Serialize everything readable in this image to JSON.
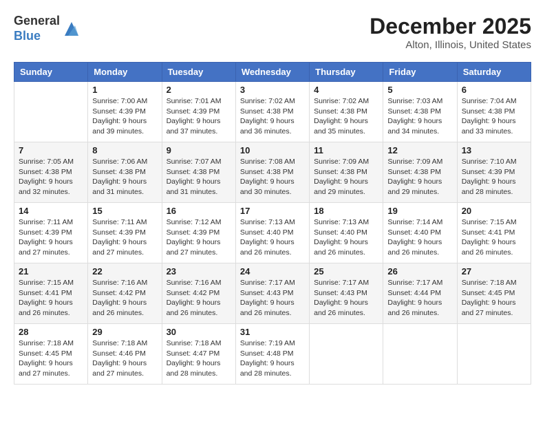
{
  "header": {
    "logo_line1": "General",
    "logo_line2": "Blue",
    "month_title": "December 2025",
    "location": "Alton, Illinois, United States"
  },
  "weekdays": [
    "Sunday",
    "Monday",
    "Tuesday",
    "Wednesday",
    "Thursday",
    "Friday",
    "Saturday"
  ],
  "weeks": [
    [
      {
        "day": "",
        "info": ""
      },
      {
        "day": "1",
        "info": "Sunrise: 7:00 AM\nSunset: 4:39 PM\nDaylight: 9 hours\nand 39 minutes."
      },
      {
        "day": "2",
        "info": "Sunrise: 7:01 AM\nSunset: 4:39 PM\nDaylight: 9 hours\nand 37 minutes."
      },
      {
        "day": "3",
        "info": "Sunrise: 7:02 AM\nSunset: 4:38 PM\nDaylight: 9 hours\nand 36 minutes."
      },
      {
        "day": "4",
        "info": "Sunrise: 7:02 AM\nSunset: 4:38 PM\nDaylight: 9 hours\nand 35 minutes."
      },
      {
        "day": "5",
        "info": "Sunrise: 7:03 AM\nSunset: 4:38 PM\nDaylight: 9 hours\nand 34 minutes."
      },
      {
        "day": "6",
        "info": "Sunrise: 7:04 AM\nSunset: 4:38 PM\nDaylight: 9 hours\nand 33 minutes."
      }
    ],
    [
      {
        "day": "7",
        "info": "Sunrise: 7:05 AM\nSunset: 4:38 PM\nDaylight: 9 hours\nand 32 minutes."
      },
      {
        "day": "8",
        "info": "Sunrise: 7:06 AM\nSunset: 4:38 PM\nDaylight: 9 hours\nand 31 minutes."
      },
      {
        "day": "9",
        "info": "Sunrise: 7:07 AM\nSunset: 4:38 PM\nDaylight: 9 hours\nand 31 minutes."
      },
      {
        "day": "10",
        "info": "Sunrise: 7:08 AM\nSunset: 4:38 PM\nDaylight: 9 hours\nand 30 minutes."
      },
      {
        "day": "11",
        "info": "Sunrise: 7:09 AM\nSunset: 4:38 PM\nDaylight: 9 hours\nand 29 minutes."
      },
      {
        "day": "12",
        "info": "Sunrise: 7:09 AM\nSunset: 4:38 PM\nDaylight: 9 hours\nand 29 minutes."
      },
      {
        "day": "13",
        "info": "Sunrise: 7:10 AM\nSunset: 4:39 PM\nDaylight: 9 hours\nand 28 minutes."
      }
    ],
    [
      {
        "day": "14",
        "info": "Sunrise: 7:11 AM\nSunset: 4:39 PM\nDaylight: 9 hours\nand 27 minutes."
      },
      {
        "day": "15",
        "info": "Sunrise: 7:11 AM\nSunset: 4:39 PM\nDaylight: 9 hours\nand 27 minutes."
      },
      {
        "day": "16",
        "info": "Sunrise: 7:12 AM\nSunset: 4:39 PM\nDaylight: 9 hours\nand 27 minutes."
      },
      {
        "day": "17",
        "info": "Sunrise: 7:13 AM\nSunset: 4:40 PM\nDaylight: 9 hours\nand 26 minutes."
      },
      {
        "day": "18",
        "info": "Sunrise: 7:13 AM\nSunset: 4:40 PM\nDaylight: 9 hours\nand 26 minutes."
      },
      {
        "day": "19",
        "info": "Sunrise: 7:14 AM\nSunset: 4:40 PM\nDaylight: 9 hours\nand 26 minutes."
      },
      {
        "day": "20",
        "info": "Sunrise: 7:15 AM\nSunset: 4:41 PM\nDaylight: 9 hours\nand 26 minutes."
      }
    ],
    [
      {
        "day": "21",
        "info": "Sunrise: 7:15 AM\nSunset: 4:41 PM\nDaylight: 9 hours\nand 26 minutes."
      },
      {
        "day": "22",
        "info": "Sunrise: 7:16 AM\nSunset: 4:42 PM\nDaylight: 9 hours\nand 26 minutes."
      },
      {
        "day": "23",
        "info": "Sunrise: 7:16 AM\nSunset: 4:42 PM\nDaylight: 9 hours\nand 26 minutes."
      },
      {
        "day": "24",
        "info": "Sunrise: 7:17 AM\nSunset: 4:43 PM\nDaylight: 9 hours\nand 26 minutes."
      },
      {
        "day": "25",
        "info": "Sunrise: 7:17 AM\nSunset: 4:43 PM\nDaylight: 9 hours\nand 26 minutes."
      },
      {
        "day": "26",
        "info": "Sunrise: 7:17 AM\nSunset: 4:44 PM\nDaylight: 9 hours\nand 26 minutes."
      },
      {
        "day": "27",
        "info": "Sunrise: 7:18 AM\nSunset: 4:45 PM\nDaylight: 9 hours\nand 27 minutes."
      }
    ],
    [
      {
        "day": "28",
        "info": "Sunrise: 7:18 AM\nSunset: 4:45 PM\nDaylight: 9 hours\nand 27 minutes."
      },
      {
        "day": "29",
        "info": "Sunrise: 7:18 AM\nSunset: 4:46 PM\nDaylight: 9 hours\nand 27 minutes."
      },
      {
        "day": "30",
        "info": "Sunrise: 7:18 AM\nSunset: 4:47 PM\nDaylight: 9 hours\nand 28 minutes."
      },
      {
        "day": "31",
        "info": "Sunrise: 7:19 AM\nSunset: 4:48 PM\nDaylight: 9 hours\nand 28 minutes."
      },
      {
        "day": "",
        "info": ""
      },
      {
        "day": "",
        "info": ""
      },
      {
        "day": "",
        "info": ""
      }
    ]
  ]
}
